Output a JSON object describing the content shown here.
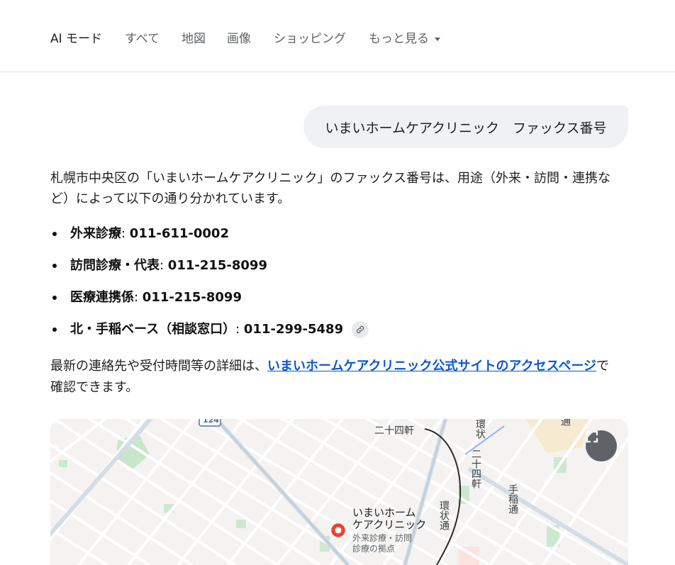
{
  "nav": {
    "tabs": [
      {
        "label": "AI モード",
        "active": true
      },
      {
        "label": "すべて"
      },
      {
        "label": "地図"
      },
      {
        "label": "画像"
      },
      {
        "label": "ショッピング"
      },
      {
        "label": "もっと見る"
      }
    ]
  },
  "query": "いまいホームケアクリニック　ファックス番号",
  "answer": {
    "intro": "札幌市中央区の「いまいホームケアクリニック」のファックス番号は、用途（外来・訪問・連携など）によって以下の通り分かれています。",
    "fax_numbers": [
      {
        "label": "外来診療",
        "number": "011-611-0002"
      },
      {
        "label": "訪問診療・代表",
        "number": "011-215-8099"
      },
      {
        "label": "医療連携係",
        "number": "011-215-8099"
      },
      {
        "label": "北・手稲ベース（相談窓口）",
        "number": "011-299-5489",
        "has_source_link": true
      }
    ],
    "separator": ": ",
    "outro_before": "最新の連絡先や受付時間等の詳細は、",
    "outro_link": "いまいホームケアクリニック公式サイトのアクセスページ",
    "outro_after": "で確認できます。"
  },
  "map": {
    "route_badge": "124",
    "labels": {
      "station_top": "二十四軒",
      "street_v1": "二十四軒",
      "street_v2": "手稲通",
      "street_v3": "環状通",
      "street_v4": "環状",
      "street_v5": "通"
    },
    "clinic_name": "いまいホーム\nケアクリニック",
    "clinic_sub": "外来診療・訪問\n診療の拠点",
    "colors": {
      "marker": "#ea4335",
      "park": "#c8e6c9",
      "road": "#ffffff",
      "accent_link": "#0b57d0"
    }
  },
  "icons": {
    "link": "link-icon",
    "expand": "expand-icon",
    "marker": "map-pin-icon"
  }
}
